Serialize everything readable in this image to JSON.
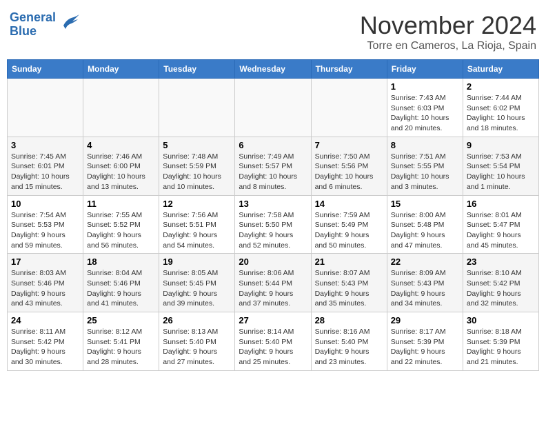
{
  "header": {
    "logo_line1": "General",
    "logo_line2": "Blue",
    "month": "November 2024",
    "location": "Torre en Cameros, La Rioja, Spain"
  },
  "weekdays": [
    "Sunday",
    "Monday",
    "Tuesday",
    "Wednesday",
    "Thursday",
    "Friday",
    "Saturday"
  ],
  "weeks": [
    [
      {
        "day": "",
        "info": ""
      },
      {
        "day": "",
        "info": ""
      },
      {
        "day": "",
        "info": ""
      },
      {
        "day": "",
        "info": ""
      },
      {
        "day": "",
        "info": ""
      },
      {
        "day": "1",
        "info": "Sunrise: 7:43 AM\nSunset: 6:03 PM\nDaylight: 10 hours\nand 20 minutes."
      },
      {
        "day": "2",
        "info": "Sunrise: 7:44 AM\nSunset: 6:02 PM\nDaylight: 10 hours\nand 18 minutes."
      }
    ],
    [
      {
        "day": "3",
        "info": "Sunrise: 7:45 AM\nSunset: 6:01 PM\nDaylight: 10 hours\nand 15 minutes."
      },
      {
        "day": "4",
        "info": "Sunrise: 7:46 AM\nSunset: 6:00 PM\nDaylight: 10 hours\nand 13 minutes."
      },
      {
        "day": "5",
        "info": "Sunrise: 7:48 AM\nSunset: 5:59 PM\nDaylight: 10 hours\nand 10 minutes."
      },
      {
        "day": "6",
        "info": "Sunrise: 7:49 AM\nSunset: 5:57 PM\nDaylight: 10 hours\nand 8 minutes."
      },
      {
        "day": "7",
        "info": "Sunrise: 7:50 AM\nSunset: 5:56 PM\nDaylight: 10 hours\nand 6 minutes."
      },
      {
        "day": "8",
        "info": "Sunrise: 7:51 AM\nSunset: 5:55 PM\nDaylight: 10 hours\nand 3 minutes."
      },
      {
        "day": "9",
        "info": "Sunrise: 7:53 AM\nSunset: 5:54 PM\nDaylight: 10 hours\nand 1 minute."
      }
    ],
    [
      {
        "day": "10",
        "info": "Sunrise: 7:54 AM\nSunset: 5:53 PM\nDaylight: 9 hours\nand 59 minutes."
      },
      {
        "day": "11",
        "info": "Sunrise: 7:55 AM\nSunset: 5:52 PM\nDaylight: 9 hours\nand 56 minutes."
      },
      {
        "day": "12",
        "info": "Sunrise: 7:56 AM\nSunset: 5:51 PM\nDaylight: 9 hours\nand 54 minutes."
      },
      {
        "day": "13",
        "info": "Sunrise: 7:58 AM\nSunset: 5:50 PM\nDaylight: 9 hours\nand 52 minutes."
      },
      {
        "day": "14",
        "info": "Sunrise: 7:59 AM\nSunset: 5:49 PM\nDaylight: 9 hours\nand 50 minutes."
      },
      {
        "day": "15",
        "info": "Sunrise: 8:00 AM\nSunset: 5:48 PM\nDaylight: 9 hours\nand 47 minutes."
      },
      {
        "day": "16",
        "info": "Sunrise: 8:01 AM\nSunset: 5:47 PM\nDaylight: 9 hours\nand 45 minutes."
      }
    ],
    [
      {
        "day": "17",
        "info": "Sunrise: 8:03 AM\nSunset: 5:46 PM\nDaylight: 9 hours\nand 43 minutes."
      },
      {
        "day": "18",
        "info": "Sunrise: 8:04 AM\nSunset: 5:46 PM\nDaylight: 9 hours\nand 41 minutes."
      },
      {
        "day": "19",
        "info": "Sunrise: 8:05 AM\nSunset: 5:45 PM\nDaylight: 9 hours\nand 39 minutes."
      },
      {
        "day": "20",
        "info": "Sunrise: 8:06 AM\nSunset: 5:44 PM\nDaylight: 9 hours\nand 37 minutes."
      },
      {
        "day": "21",
        "info": "Sunrise: 8:07 AM\nSunset: 5:43 PM\nDaylight: 9 hours\nand 35 minutes."
      },
      {
        "day": "22",
        "info": "Sunrise: 8:09 AM\nSunset: 5:43 PM\nDaylight: 9 hours\nand 34 minutes."
      },
      {
        "day": "23",
        "info": "Sunrise: 8:10 AM\nSunset: 5:42 PM\nDaylight: 9 hours\nand 32 minutes."
      }
    ],
    [
      {
        "day": "24",
        "info": "Sunrise: 8:11 AM\nSunset: 5:42 PM\nDaylight: 9 hours\nand 30 minutes."
      },
      {
        "day": "25",
        "info": "Sunrise: 8:12 AM\nSunset: 5:41 PM\nDaylight: 9 hours\nand 28 minutes."
      },
      {
        "day": "26",
        "info": "Sunrise: 8:13 AM\nSunset: 5:40 PM\nDaylight: 9 hours\nand 27 minutes."
      },
      {
        "day": "27",
        "info": "Sunrise: 8:14 AM\nSunset: 5:40 PM\nDaylight: 9 hours\nand 25 minutes."
      },
      {
        "day": "28",
        "info": "Sunrise: 8:16 AM\nSunset: 5:40 PM\nDaylight: 9 hours\nand 23 minutes."
      },
      {
        "day": "29",
        "info": "Sunrise: 8:17 AM\nSunset: 5:39 PM\nDaylight: 9 hours\nand 22 minutes."
      },
      {
        "day": "30",
        "info": "Sunrise: 8:18 AM\nSunset: 5:39 PM\nDaylight: 9 hours\nand 21 minutes."
      }
    ]
  ]
}
